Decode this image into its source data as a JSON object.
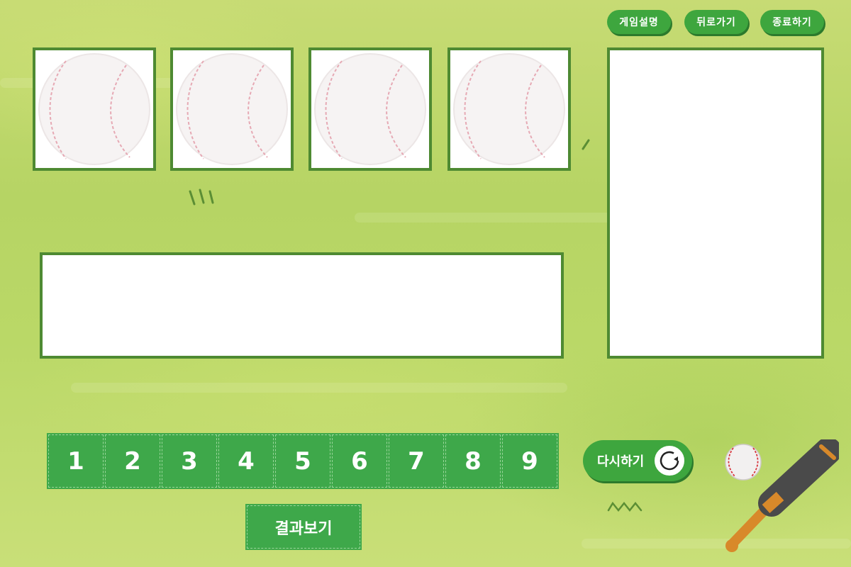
{
  "header": {
    "help_label": "게임설명",
    "back_label": "뒤로가기",
    "exit_label": "종료하기"
  },
  "cards": [
    {
      "icon": "baseball-icon"
    },
    {
      "icon": "baseball-icon"
    },
    {
      "icon": "baseball-icon"
    },
    {
      "icon": "baseball-icon"
    }
  ],
  "number_pad": [
    "1",
    "2",
    "3",
    "4",
    "5",
    "6",
    "7",
    "8",
    "9"
  ],
  "controls": {
    "retry_label": "다시하기",
    "result_label": "결과보기"
  },
  "colors": {
    "accent_green": "#3ea63e",
    "frame_green": "#4e8a32",
    "background": "#bcd66a"
  }
}
